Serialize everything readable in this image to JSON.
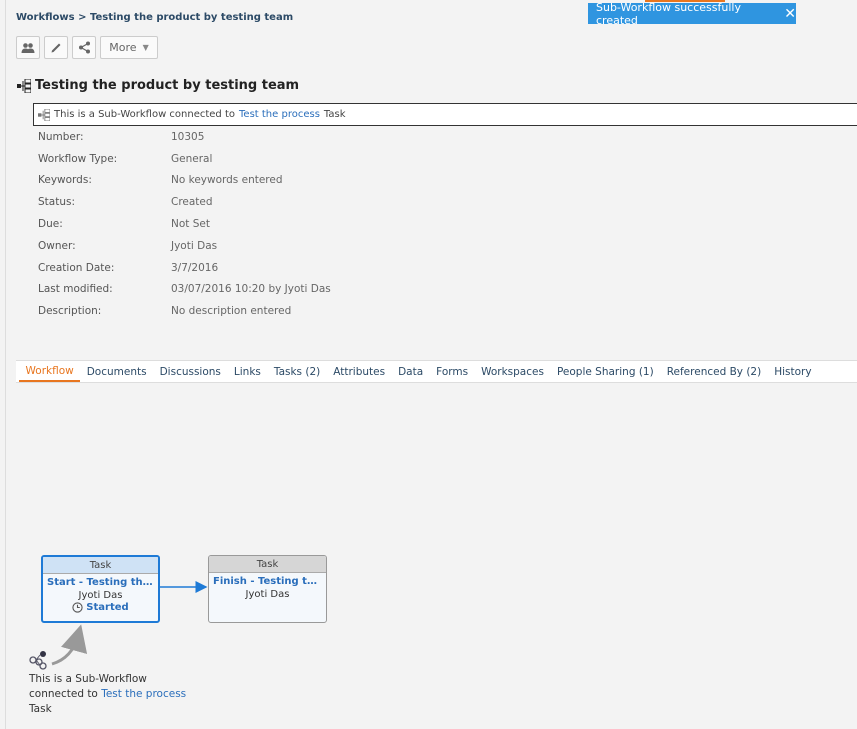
{
  "breadcrumb": {
    "root": "Workflows",
    "separator": ">",
    "current": "Testing the product by testing team"
  },
  "toast": {
    "message": "Sub-Workflow successfully created",
    "close": "✕"
  },
  "toolbar": {
    "more_label": "More"
  },
  "title": "Testing the product by testing team",
  "subworkflow_banner": {
    "prefix": "This is a Sub-Workflow connected to",
    "link": "Test the process",
    "suffix": "Task"
  },
  "properties": [
    {
      "label": "Number:",
      "value": "10305"
    },
    {
      "label": "Workflow Type:",
      "value": "General"
    },
    {
      "label": "Keywords:",
      "value": "No keywords entered"
    },
    {
      "label": "Status:",
      "value": "Created"
    },
    {
      "label": "Due:",
      "value": "Not Set"
    },
    {
      "label": "Owner:",
      "value": "Jyoti Das"
    },
    {
      "label": "Creation Date:",
      "value": "3/7/2016"
    },
    {
      "label": "Last modified:",
      "value": "03/07/2016 10:20 by Jyoti Das"
    },
    {
      "label": "Description:",
      "value": "No description entered"
    }
  ],
  "tabs": [
    {
      "label": "Workflow",
      "active": true
    },
    {
      "label": "Documents"
    },
    {
      "label": "Discussions"
    },
    {
      "label": "Links"
    },
    {
      "label": "Tasks (2)"
    },
    {
      "label": "Attributes"
    },
    {
      "label": "Data"
    },
    {
      "label": "Forms"
    },
    {
      "label": "Workspaces"
    },
    {
      "label": "People Sharing (1)"
    },
    {
      "label": "Referenced By (2)"
    },
    {
      "label": "History"
    }
  ],
  "nodes": {
    "start": {
      "header": "Task",
      "name": "Start - Testing the ...",
      "owner": "Jyoti Das",
      "state": "Started"
    },
    "finish": {
      "header": "Task",
      "name": "Finish - Testing the...",
      "owner": "Jyoti Das"
    }
  },
  "subworkflow_note": {
    "line1": "This is a Sub-Workflow",
    "line2_prefix": "connected to",
    "link": "Test the process",
    "line3": "Task"
  },
  "colors": {
    "accent": "#e8761f",
    "link": "#2a6ebb",
    "toast": "#2f95e0"
  }
}
